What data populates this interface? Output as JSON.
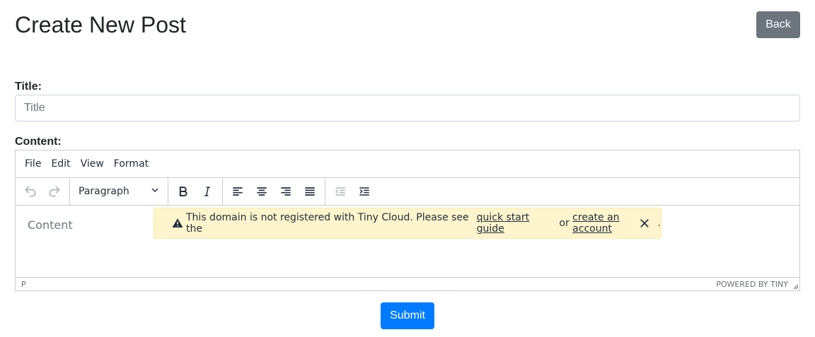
{
  "page": {
    "title": "Create New Post",
    "back_label": "Back"
  },
  "form": {
    "title_label": "Title:",
    "title_placeholder": "Title",
    "content_label": "Content:",
    "submit_label": "Submit"
  },
  "editor": {
    "menu": [
      "File",
      "Edit",
      "View",
      "Format"
    ],
    "block_format": "Paragraph",
    "content_placeholder": "Content",
    "notice": {
      "text_before": "This domain is not registered with Tiny Cloud. Please see the",
      "link1": "quick start guide",
      "text_middle": "or",
      "link2": "create an account",
      "text_after": "."
    },
    "status_path": "P",
    "branding": "POWERED BY TINY"
  },
  "icons": {
    "undo": "undo-icon",
    "redo": "redo-icon",
    "bold": "bold-icon",
    "italic": "italic-icon",
    "align_left": "align-left-icon",
    "align_center": "align-center-icon",
    "align_right": "align-right-icon",
    "align_justify": "align-justify-icon",
    "outdent": "outdent-icon",
    "indent": "indent-icon",
    "warning": "warning-icon",
    "close": "close-icon",
    "chevron": "chevron-down-icon"
  },
  "colors": {
    "back_button": "#6c757d",
    "submit_button": "#007bff",
    "notice_bg": "#fff5cc"
  }
}
